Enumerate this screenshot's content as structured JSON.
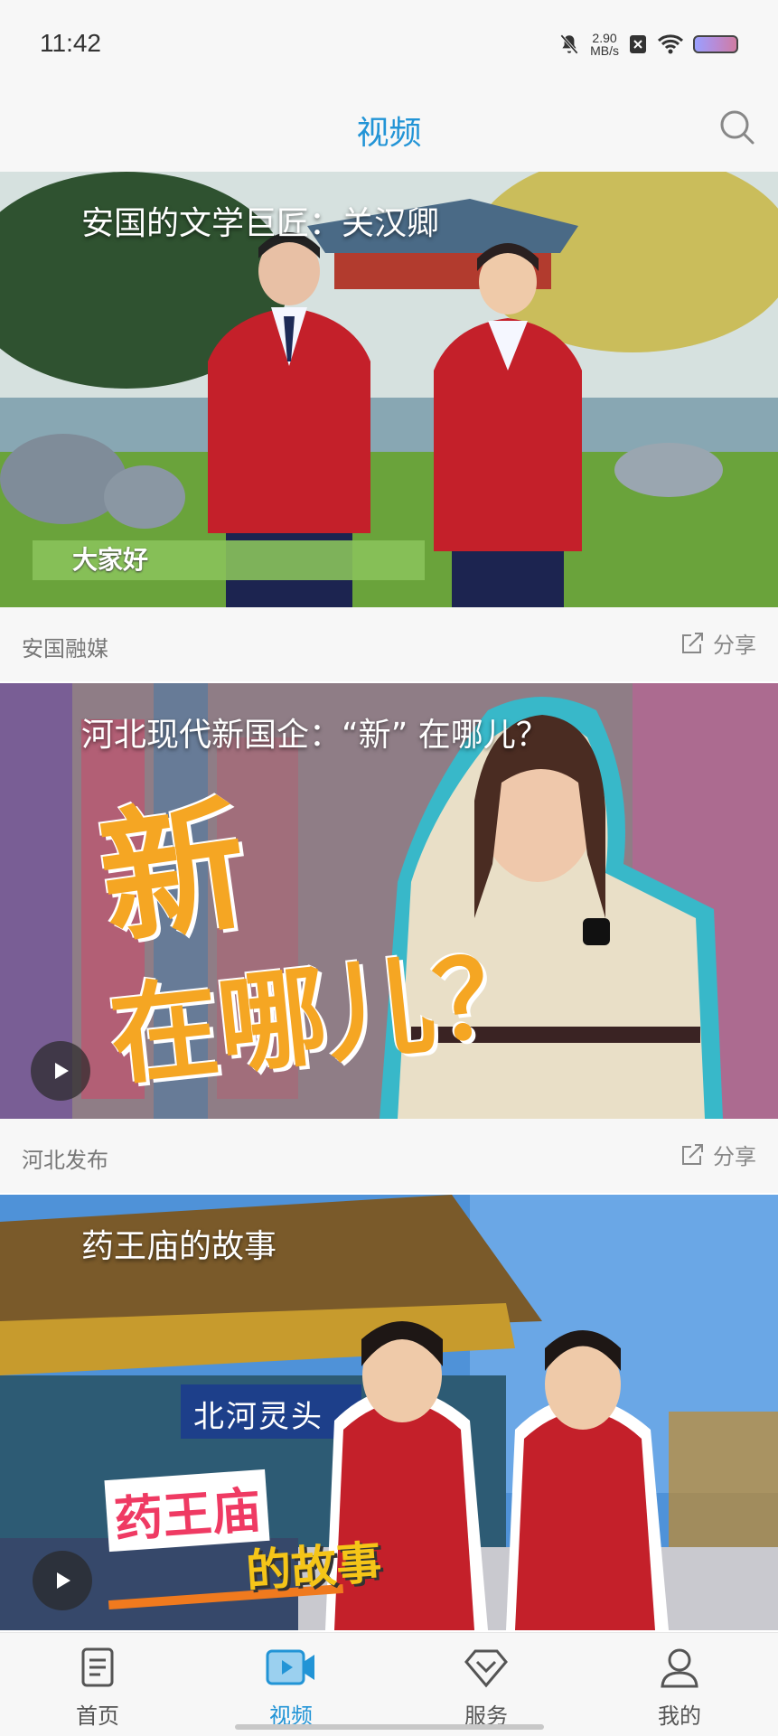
{
  "status": {
    "time": "11:42",
    "speed_value": "2.90",
    "speed_unit": "MB/s"
  },
  "header": {
    "title": "视频",
    "search_icon": "search-icon"
  },
  "videos": [
    {
      "title": "安国的文学巨匠：关汉卿",
      "caption": "大家好",
      "source": "安国融媒",
      "share_label": "分享"
    },
    {
      "title": "河北现代新国企：“新” 在哪儿？",
      "overlay_text_1": "新",
      "overlay_text_2": "在哪儿？",
      "source": "河北发布",
      "share_label": "分享"
    },
    {
      "title": "药王庙的故事",
      "overlay_text_1": "药王庙",
      "overlay_text_2": "的故事",
      "gate_plaque": "北河灵头"
    }
  ],
  "tabbar": {
    "items": [
      {
        "label": "首页",
        "icon": "news-icon"
      },
      {
        "label": "视频",
        "icon": "video-icon",
        "active": true
      },
      {
        "label": "服务",
        "icon": "service-icon"
      },
      {
        "label": "我的",
        "icon": "profile-icon"
      }
    ]
  },
  "colors": {
    "accent": "#2294d6",
    "background": "#f7f7f7",
    "overlay_orange": "#f5a623"
  }
}
